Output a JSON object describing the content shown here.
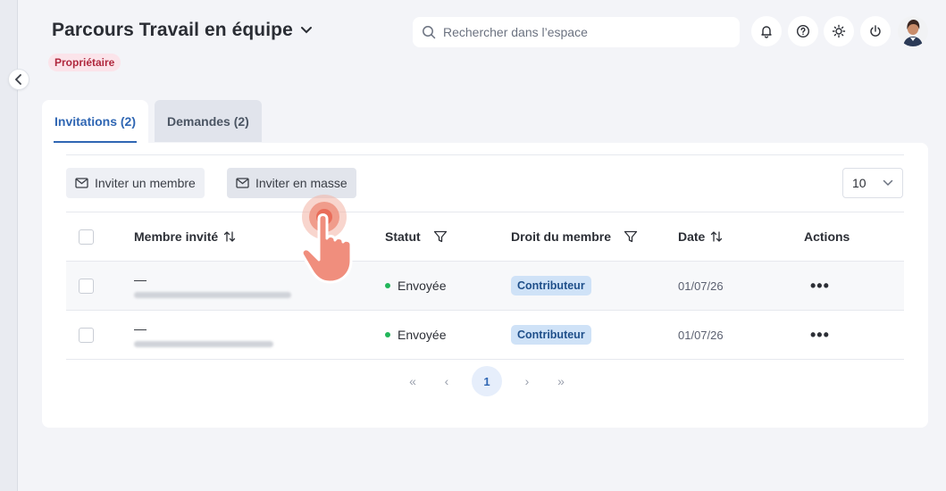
{
  "header": {
    "title": "Parcours Travail en équipe",
    "role_badge": "Propriétaire",
    "search_placeholder": "Rechercher dans l’espace"
  },
  "tabs": [
    {
      "label": "Invitations (2)",
      "active": true
    },
    {
      "label": "Demandes (2)",
      "active": false
    }
  ],
  "toolbar": {
    "invite_member": "Inviter un membre",
    "invite_bulk": "Inviter en masse",
    "page_size": "10"
  },
  "table": {
    "columns": {
      "member": "Membre invité",
      "status": "Statut",
      "right": "Droit du membre",
      "date": "Date",
      "actions": "Actions"
    },
    "rows": [
      {
        "name": "—",
        "status": "Envoyée",
        "right": "Contributeur",
        "date": "01/07/26",
        "actions": "•••"
      },
      {
        "name": "—",
        "status": "Envoyée",
        "right": "Contributeur",
        "date": "01/07/26",
        "actions": "•••"
      }
    ]
  },
  "pagination": {
    "first": "«",
    "prev": "‹",
    "current": "1",
    "next": "›",
    "last": "»"
  },
  "colors": {
    "accent": "#2f66b3",
    "badge_bg": "#fbe4ea",
    "badge_text": "#b0283e",
    "status_sent": "#22b65a",
    "chip_bg": "#cfe2f7"
  },
  "icons": [
    "chevron-left-icon",
    "chevron-down-icon",
    "search-icon",
    "bell-icon",
    "help-icon",
    "sun-icon",
    "power-icon",
    "mail-icon",
    "sort-icon",
    "filter-icon"
  ]
}
